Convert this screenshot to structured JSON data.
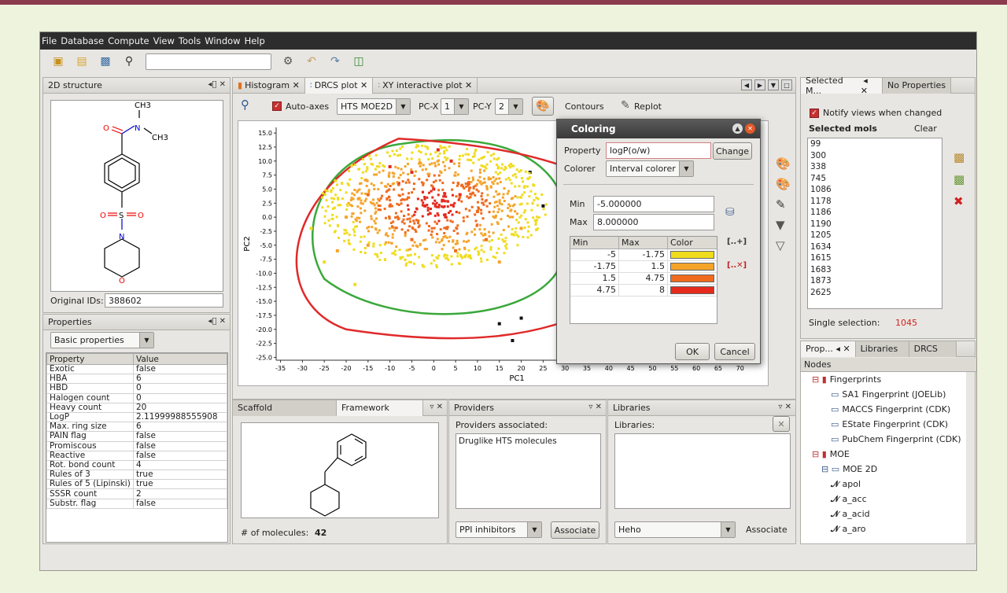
{
  "menu": [
    "File",
    "Database",
    "Compute",
    "View",
    "Tools",
    "Window",
    "Help"
  ],
  "structure_panel": {
    "title": "2D structure",
    "original_ids_label": "Original IDs:",
    "original_ids_value": "388602",
    "atoms": {
      "ch3_top": "CH3",
      "n": "N",
      "ch3_right": "CH3",
      "o_carbonyl": "O",
      "s": "S",
      "o_left": "O",
      "o_right": "O",
      "n_ring": "N",
      "o_ring": "O"
    }
  },
  "properties_panel": {
    "title": "Properties",
    "selector": "Basic properties",
    "col_property": "Property",
    "col_value": "Value",
    "rows": [
      [
        "Exotic",
        "false"
      ],
      [
        "HBA",
        "6"
      ],
      [
        "HBD",
        "0"
      ],
      [
        "Halogen count",
        "0"
      ],
      [
        "Heavy count",
        "20"
      ],
      [
        "LogP",
        "2.11999988555908"
      ],
      [
        "Max. ring size",
        "6"
      ],
      [
        "PAIN flag",
        "false"
      ],
      [
        "Promiscous",
        "false"
      ],
      [
        "Reactive",
        "false"
      ],
      [
        "Rot. bond count",
        "4"
      ],
      [
        "Rules of 3",
        "true"
      ],
      [
        "Rules of 5 (Lipinski)",
        "true"
      ],
      [
        "SSSR count",
        "2"
      ],
      [
        "Substr. flag",
        "false"
      ]
    ]
  },
  "center_tabs": [
    "Histogram",
    "DRCS plot",
    "XY interactive plot"
  ],
  "plot_toolbar": {
    "auto_axes": "Auto-axes",
    "dataset": "HTS MOE2D",
    "pcx_label": "PC-X",
    "pcx": "1",
    "pcy_label": "PC-Y",
    "pcy": "2",
    "contours": "Contours",
    "replot": "Replot"
  },
  "chart_data": {
    "type": "scatter",
    "xlabel": "PC1",
    "ylabel": "PC2",
    "x_ticks": [
      "-35",
      "-30",
      "-25",
      "-20",
      "-15",
      "-10",
      "-5",
      "0",
      "5",
      "10",
      "15",
      "20",
      "25",
      "30",
      "35",
      "40",
      "45",
      "50",
      "55",
      "60",
      "65",
      "70"
    ],
    "y_ticks": [
      "15.0",
      "12.5",
      "10.0",
      "7.5",
      "5.0",
      "2.5",
      "0.0",
      "-2.5",
      "-5.0",
      "-7.5",
      "-10.0",
      "-12.5",
      "-15.0",
      "-17.5",
      "-20.0",
      "-22.5",
      "-25.0"
    ],
    "xlim": [
      -36,
      74
    ],
    "ylim": [
      -25.5,
      16
    ],
    "series": [
      {
        "color": "#e52a1e",
        "points": [
          [
            -5,
            8
          ],
          [
            0,
            5
          ],
          [
            2,
            3
          ],
          [
            -8,
            6
          ],
          [
            4,
            10
          ],
          [
            -2,
            2
          ],
          [
            6,
            4
          ],
          [
            -10,
            9
          ],
          [
            1,
            12
          ],
          [
            8,
            6
          ]
        ]
      },
      {
        "color": "#f06a1e",
        "points": [
          [
            -10,
            2
          ],
          [
            3,
            -2
          ],
          [
            10,
            1
          ],
          [
            -15,
            4
          ],
          [
            12,
            -4
          ],
          [
            -5,
            -4
          ],
          [
            5,
            -6
          ]
        ]
      },
      {
        "color": "#f5a42a",
        "points": [
          [
            -15,
            -5
          ],
          [
            -20,
            0
          ],
          [
            15,
            -8
          ],
          [
            -22,
            -6
          ],
          [
            20,
            -2
          ]
        ]
      },
      {
        "color": "#f0dc1e",
        "points": [
          [
            -25,
            -8
          ],
          [
            -18,
            -12
          ],
          [
            -28,
            -2
          ]
        ]
      },
      {
        "color": "#111111",
        "points": [
          [
            22,
            8
          ],
          [
            25,
            2
          ],
          [
            30,
            -5
          ],
          [
            20,
            -18
          ],
          [
            15,
            -19
          ],
          [
            18,
            -22
          ]
        ]
      }
    ]
  },
  "coloring_dialog": {
    "title": "Coloring",
    "property_label": "Property",
    "property_value": "logP(o/w)",
    "change": "Change",
    "colorer_label": "Colorer",
    "colorer_value": "Interval colorer",
    "min_label": "Min",
    "min_value": "-5.000000",
    "max_label": "Max",
    "max_value": "8.000000",
    "col_min": "Min",
    "col_max": "Max",
    "col_color": "Color",
    "intervals": [
      {
        "min": "-5",
        "max": "-1.75",
        "color": "#f0dc1e"
      },
      {
        "min": "-1.75",
        "max": "1.5",
        "color": "#f5a42a"
      },
      {
        "min": "1.5",
        "max": "4.75",
        "color": "#f06a1e"
      },
      {
        "min": "4.75",
        "max": "8",
        "color": "#e52a1e"
      }
    ],
    "ok": "OK",
    "cancel": "Cancel"
  },
  "scaffold_panel": {
    "tab1": "Scaffold",
    "tab2": "Framework",
    "count_label": "# of molecules:",
    "count": "42"
  },
  "providers_panel": {
    "title": "Providers",
    "assoc_label": "Providers associated:",
    "items": [
      "Druglike HTS molecules"
    ],
    "combo": "PPI inhibitors",
    "associate": "Associate"
  },
  "libraries_panel": {
    "title": "Libraries",
    "label": "Libraries:",
    "combo": "Heho",
    "associate": "Associate"
  },
  "selected_panel": {
    "tab1": "Selected M...",
    "tab2": "No Properties",
    "notify": "Notify views when changed",
    "heading": "Selected mols",
    "clear": "Clear",
    "items": [
      "99",
      "300",
      "338",
      "745",
      "1086",
      "1178",
      "1186",
      "1190",
      "1205",
      "1634",
      "1615",
      "1683",
      "1873",
      "2625"
    ],
    "single_label": "Single selection:",
    "single_value": "1045"
  },
  "nodes_panel": {
    "tab1": "Prop...",
    "tab2": "Libraries",
    "tab3": "DRCS",
    "header": "Nodes",
    "tree": [
      {
        "label": "Fingerprints",
        "level": 0,
        "kind": "folder"
      },
      {
        "label": "SA1 Fingerprint (JOELib)",
        "level": 2,
        "kind": "fp"
      },
      {
        "label": "MACCS Fingerprint (CDK)",
        "level": 2,
        "kind": "fp"
      },
      {
        "label": "EState Fingerprint (CDK)",
        "level": 2,
        "kind": "fp"
      },
      {
        "label": "PubChem Fingerprint (CDK)",
        "level": 2,
        "kind": "fp"
      },
      {
        "label": "MOE",
        "level": 0,
        "kind": "folder"
      },
      {
        "label": "MOE 2D",
        "level": 1,
        "kind": "table"
      },
      {
        "label": "apol",
        "level": 2,
        "kind": "desc"
      },
      {
        "label": "a_acc",
        "level": 2,
        "kind": "desc"
      },
      {
        "label": "a_acid",
        "level": 2,
        "kind": "desc"
      },
      {
        "label": "a_aro",
        "level": 2,
        "kind": "desc"
      }
    ]
  }
}
